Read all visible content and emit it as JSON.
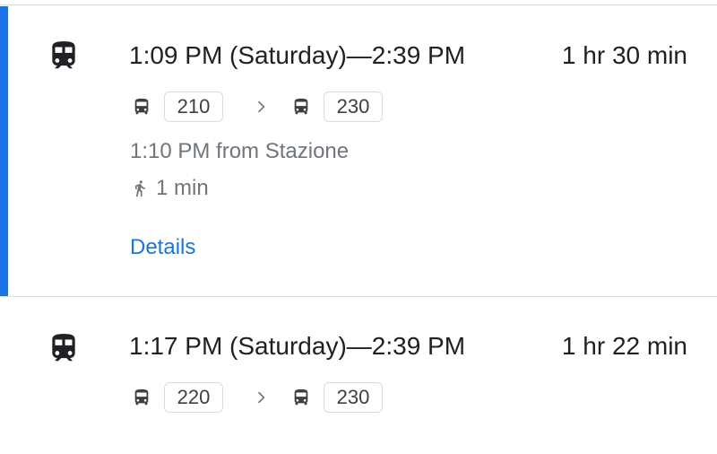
{
  "colors": {
    "accent": "#1a73e8",
    "primary_text": "#202124",
    "secondary_text": "#70757a",
    "border": "#dadce0"
  },
  "routes": [
    {
      "mode_icon": "train-icon",
      "times": "1:09 PM (Saturday)—2:39 PM",
      "duration": "1 hr 30 min",
      "legs": [
        {
          "icon": "bus-icon",
          "line": "210"
        },
        {
          "icon": "bus-icon",
          "line": "230"
        }
      ],
      "departure": "1:10 PM from Stazione",
      "walk_icon": "walking-icon",
      "walk": "1 min",
      "details_label": "Details",
      "selected": true
    },
    {
      "mode_icon": "train-icon",
      "times": "1:17 PM (Saturday)—2:39 PM",
      "duration": "1 hr 22 min",
      "legs": [
        {
          "icon": "bus-icon",
          "line": "220"
        },
        {
          "icon": "bus-icon",
          "line": "230"
        }
      ],
      "selected": false
    }
  ]
}
